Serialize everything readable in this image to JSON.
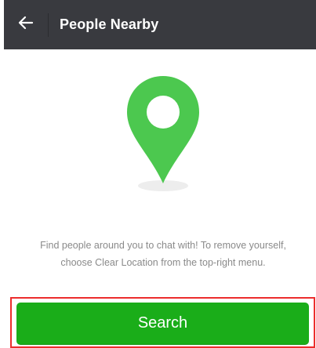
{
  "colors": {
    "header_bg": "#393a3f",
    "header_text": "#ffffff",
    "accent_green": "#1aad19",
    "pin_green": "#4cc84f",
    "description_text": "#8a8a8a",
    "highlight_border": "#ec2d2d"
  },
  "header": {
    "back_icon": "back-arrow-icon",
    "title": "People Nearby"
  },
  "hero": {
    "icon": "location-pin-icon"
  },
  "description": "Find people around you to chat with! To remove yourself, choose Clear Location from the top-right menu.",
  "search_button": {
    "label": "Search"
  }
}
